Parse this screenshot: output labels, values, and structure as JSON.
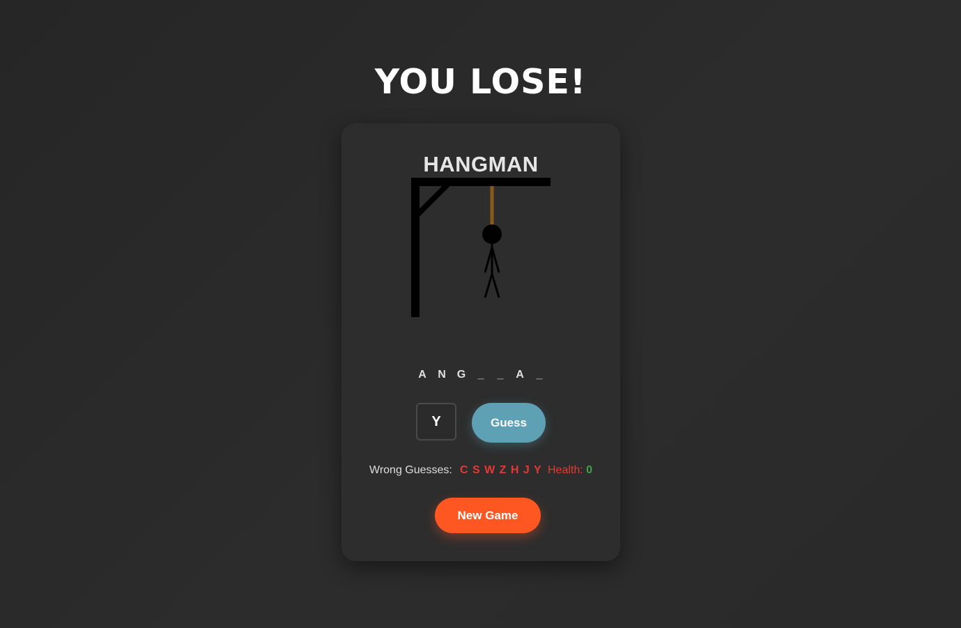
{
  "banner": {
    "text": "YOU LOSE!"
  },
  "game": {
    "title": "HANGMAN",
    "word_slots": [
      "A",
      "N",
      "G",
      "_",
      "_",
      "A",
      "_"
    ],
    "guess_input_value": "Y",
    "guess_button_label": "Guess",
    "wrong_guesses_label": "Wrong Guesses:",
    "wrong_guesses": "C S W Z H J Y",
    "health_label": "Health:",
    "health_value": "0",
    "new_game_label": "New Game"
  },
  "colors": {
    "background": "#2a2a2a",
    "card": "#2d2d2d",
    "guess_button": "#5ea0b4",
    "new_game_button": "#ff5722",
    "wrong": "#e53935",
    "health_value": "#43a047",
    "rope": "#8b5a1b"
  },
  "icons": {
    "gallows": "gallows-drawing",
    "figure": "stick-figure"
  }
}
